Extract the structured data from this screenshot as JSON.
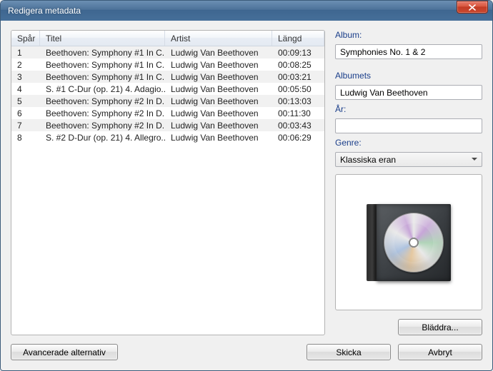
{
  "window": {
    "title": "Redigera metadata"
  },
  "table": {
    "headers": {
      "spar": "Spår",
      "titel": "Titel",
      "artist": "Artist",
      "langd": "Längd"
    },
    "rows": [
      {
        "n": "1",
        "title": "Beethoven: Symphony #1 In C...",
        "artist": "Ludwig Van Beethoven",
        "len": "00:09:13"
      },
      {
        "n": "2",
        "title": "Beethoven: Symphony #1 In C...",
        "artist": "Ludwig Van Beethoven",
        "len": "00:08:25"
      },
      {
        "n": "3",
        "title": "Beethoven: Symphony #1 In C...",
        "artist": "Ludwig Van Beethoven",
        "len": "00:03:21"
      },
      {
        "n": "4",
        "title": "S. #1 C-Dur (op. 21) 4. Adagio...",
        "artist": "Ludwig Van Beethoven",
        "len": "00:05:50"
      },
      {
        "n": "5",
        "title": "Beethoven: Symphony #2 In D...",
        "artist": "Ludwig Van Beethoven",
        "len": "00:13:03"
      },
      {
        "n": "6",
        "title": "Beethoven: Symphony #2 In D...",
        "artist": "Ludwig Van Beethoven",
        "len": "00:11:30"
      },
      {
        "n": "7",
        "title": "Beethoven: Symphony #2 In D...",
        "artist": "Ludwig Van Beethoven",
        "len": "00:03:43"
      },
      {
        "n": "8",
        "title": "S. #2 D-Dur (op. 21) 4. Allegro...",
        "artist": "Ludwig Van Beethoven",
        "len": "00:06:29"
      }
    ]
  },
  "meta": {
    "album_label": "Album:",
    "album_value": "Symphonies No. 1 & 2",
    "albumartist_label": "Albumets",
    "albumartist_value": "Ludwig Van Beethoven",
    "year_label": "År:",
    "year_value": "",
    "genre_label": "Genre:",
    "genre_value": "Klassiska eran"
  },
  "buttons": {
    "browse": "Bläddra...",
    "advanced": "Avancerade alternativ",
    "submit": "Skicka",
    "cancel": "Avbryt"
  }
}
